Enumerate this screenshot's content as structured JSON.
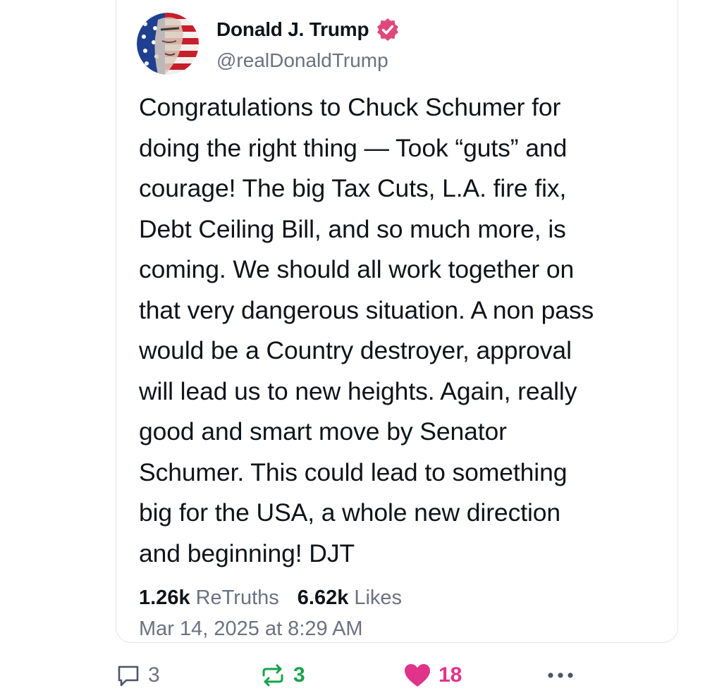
{
  "post": {
    "author_name": "Donald J. Trump",
    "handle": "@realDonaldTrump",
    "verified": true,
    "avatar": "avatar-flag-portrait",
    "text": "Congratulations to Chuck Schumer for\ndoing the right thing — Took “guts” and\ncourage! The big Tax Cuts, L.A. fire fix,\nDebt Ceiling Bill, and so much more, is\ncoming. We should all work together on\nthat very dangerous situation. A non pass\nwould be a Country destroyer, approval\nwill lead us to new heights. Again, really\ngood and smart move by Senator\nSchumer. This could lead to something\nbig for the USA, a whole new direction\nand beginning! DJT",
    "retruths_count": "1.26k",
    "retruths_label": "ReTruths",
    "likes_count": "6.62k",
    "likes_label": "Likes",
    "timestamp": "Mar 14, 2025 at 8:29 AM"
  },
  "actions": {
    "reply_count": "3",
    "retruth_count": "3",
    "like_count": "18",
    "reply_icon": "speech-bubble-icon",
    "retruth_icon": "repost-arrows-icon",
    "like_icon": "heart-icon",
    "more_icon": "ellipsis-icon"
  },
  "colors": {
    "text": "#0f1419",
    "muted": "#6b7280",
    "verified_badge": "#e0487b",
    "retruth_active": "#16a34a",
    "like_active": "#e0338a",
    "card_border": "#e3e6ea"
  }
}
